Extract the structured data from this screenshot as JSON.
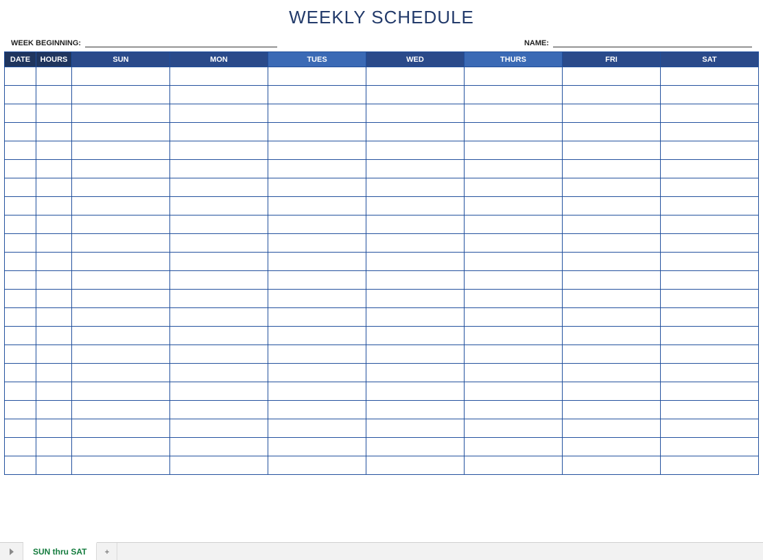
{
  "title": "WEEKLY SCHEDULE",
  "meta": {
    "week_beginning_label": "WEEK BEGINNING:",
    "week_beginning_value": "",
    "name_label": "NAME:",
    "name_value": ""
  },
  "columns": {
    "date": "DATE",
    "hours": "HOURS",
    "days": [
      "SUN",
      "MON",
      "TUES",
      "WED",
      "THURS",
      "FRI",
      "SAT"
    ]
  },
  "rows": [
    {
      "date": "",
      "hours": "",
      "sun": "",
      "mon": "",
      "tues": "",
      "wed": "",
      "thurs": "",
      "fri": "",
      "sat": ""
    },
    {
      "date": "",
      "hours": "",
      "sun": "",
      "mon": "",
      "tues": "",
      "wed": "",
      "thurs": "",
      "fri": "",
      "sat": ""
    },
    {
      "date": "",
      "hours": "",
      "sun": "",
      "mon": "",
      "tues": "",
      "wed": "",
      "thurs": "",
      "fri": "",
      "sat": ""
    },
    {
      "date": "",
      "hours": "",
      "sun": "",
      "mon": "",
      "tues": "",
      "wed": "",
      "thurs": "",
      "fri": "",
      "sat": ""
    },
    {
      "date": "",
      "hours": "",
      "sun": "",
      "mon": "",
      "tues": "",
      "wed": "",
      "thurs": "",
      "fri": "",
      "sat": ""
    },
    {
      "date": "",
      "hours": "",
      "sun": "",
      "mon": "",
      "tues": "",
      "wed": "",
      "thurs": "",
      "fri": "",
      "sat": ""
    },
    {
      "date": "",
      "hours": "",
      "sun": "",
      "mon": "",
      "tues": "",
      "wed": "",
      "thurs": "",
      "fri": "",
      "sat": ""
    },
    {
      "date": "",
      "hours": "",
      "sun": "",
      "mon": "",
      "tues": "",
      "wed": "",
      "thurs": "",
      "fri": "",
      "sat": ""
    },
    {
      "date": "",
      "hours": "",
      "sun": "",
      "mon": "",
      "tues": "",
      "wed": "",
      "thurs": "",
      "fri": "",
      "sat": ""
    },
    {
      "date": "",
      "hours": "",
      "sun": "",
      "mon": "",
      "tues": "",
      "wed": "",
      "thurs": "",
      "fri": "",
      "sat": ""
    },
    {
      "date": "",
      "hours": "",
      "sun": "",
      "mon": "",
      "tues": "",
      "wed": "",
      "thurs": "",
      "fri": "",
      "sat": ""
    },
    {
      "date": "",
      "hours": "",
      "sun": "",
      "mon": "",
      "tues": "",
      "wed": "",
      "thurs": "",
      "fri": "",
      "sat": ""
    },
    {
      "date": "",
      "hours": "",
      "sun": "",
      "mon": "",
      "tues": "",
      "wed": "",
      "thurs": "",
      "fri": "",
      "sat": ""
    },
    {
      "date": "",
      "hours": "",
      "sun": "",
      "mon": "",
      "tues": "",
      "wed": "",
      "thurs": "",
      "fri": "",
      "sat": ""
    },
    {
      "date": "",
      "hours": "",
      "sun": "",
      "mon": "",
      "tues": "",
      "wed": "",
      "thurs": "",
      "fri": "",
      "sat": ""
    },
    {
      "date": "",
      "hours": "",
      "sun": "",
      "mon": "",
      "tues": "",
      "wed": "",
      "thurs": "",
      "fri": "",
      "sat": ""
    },
    {
      "date": "",
      "hours": "",
      "sun": "",
      "mon": "",
      "tues": "",
      "wed": "",
      "thurs": "",
      "fri": "",
      "sat": ""
    },
    {
      "date": "",
      "hours": "",
      "sun": "",
      "mon": "",
      "tues": "",
      "wed": "",
      "thurs": "",
      "fri": "",
      "sat": ""
    },
    {
      "date": "",
      "hours": "",
      "sun": "",
      "mon": "",
      "tues": "",
      "wed": "",
      "thurs": "",
      "fri": "",
      "sat": ""
    },
    {
      "date": "",
      "hours": "",
      "sun": "",
      "mon": "",
      "tues": "",
      "wed": "",
      "thurs": "",
      "fri": "",
      "sat": ""
    },
    {
      "date": "",
      "hours": "",
      "sun": "",
      "mon": "",
      "tues": "",
      "wed": "",
      "thurs": "",
      "fri": "",
      "sat": ""
    },
    {
      "date": "",
      "hours": "",
      "sun": "",
      "mon": "",
      "tues": "",
      "wed": "",
      "thurs": "",
      "fri": "",
      "sat": ""
    }
  ],
  "tabs": {
    "active": "SUN thru SAT",
    "add_label": "+"
  }
}
